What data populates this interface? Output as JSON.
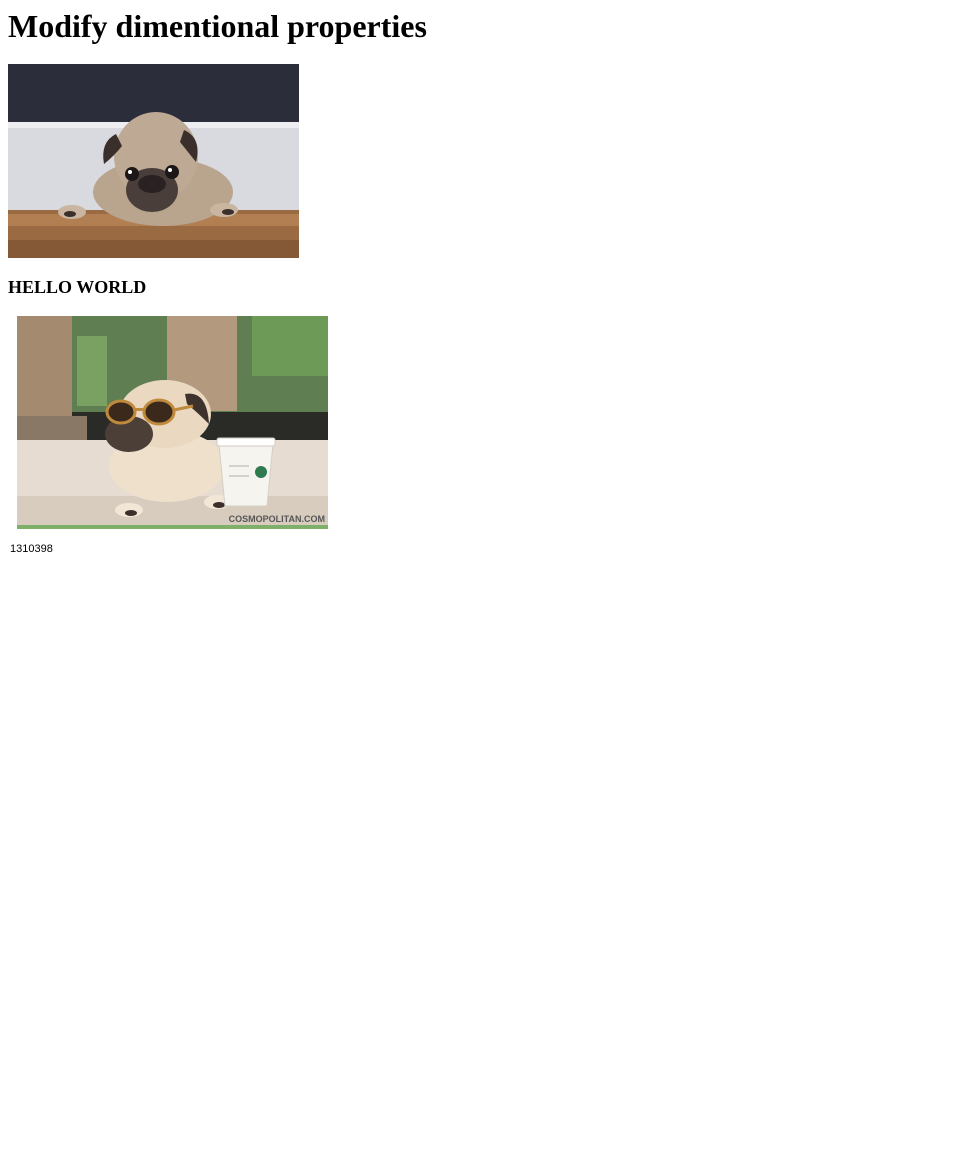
{
  "page": {
    "title": "Modify dimentional properties",
    "heading": "HELLO WORLD",
    "number_text": "1310398"
  },
  "images": [
    {
      "subject": "pug lying on wooden floor",
      "icon": "pug-photo"
    },
    {
      "subject": "pug wearing sunglasses next to a coffee cup",
      "icon": "pug-sunglasses-photo",
      "watermark": "COSMOPOLITAN.COM"
    }
  ],
  "colors": {
    "background": "#ffffff",
    "text": "#000000"
  }
}
